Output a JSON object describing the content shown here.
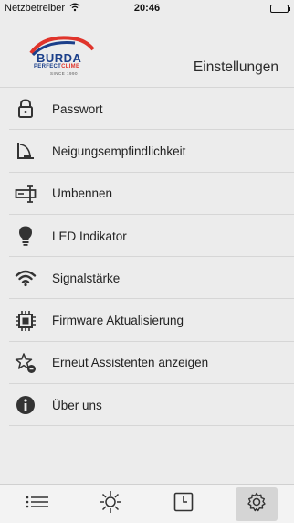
{
  "status_bar": {
    "carrier": "Netzbetreiber",
    "time": "20:46"
  },
  "header": {
    "logo": {
      "brand": "BURDA",
      "sub_a": "PERFECT",
      "sub_b": "CLIME",
      "since": "SINCE 1990"
    },
    "title": "Einstellungen"
  },
  "menu": {
    "items": [
      {
        "label": "Passwort",
        "icon": "lock-icon"
      },
      {
        "label": "Neigungsempfindlichkeit",
        "icon": "tilt-icon"
      },
      {
        "label": "Umbennen",
        "icon": "rename-icon"
      },
      {
        "label": "LED Indikator",
        "icon": "lightbulb-icon"
      },
      {
        "label": "Signalstärke",
        "icon": "wifi-icon"
      },
      {
        "label": "Firmware Aktualisierung",
        "icon": "chip-icon"
      },
      {
        "label": "Erneut Assistenten anzeigen",
        "icon": "star-wand-icon"
      },
      {
        "label": "Über uns",
        "icon": "info-icon"
      }
    ]
  },
  "tabbar": {
    "tabs": [
      {
        "icon": "list-icon",
        "active": false
      },
      {
        "icon": "sun-icon",
        "active": false
      },
      {
        "icon": "clock-icon",
        "active": false
      },
      {
        "icon": "gear-icon",
        "active": true
      }
    ]
  },
  "colors": {
    "background": "#ececec",
    "brand_blue": "#1b3f8a",
    "brand_red": "#e0342b",
    "icon": "#333333"
  }
}
